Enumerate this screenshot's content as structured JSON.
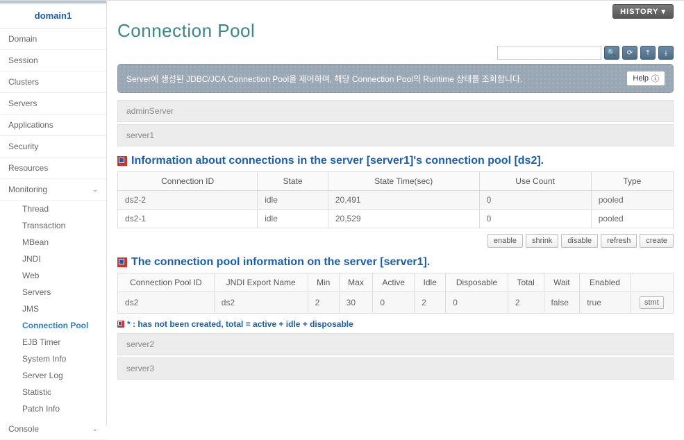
{
  "sidebar": {
    "domain": "domain1",
    "items": [
      "Domain",
      "Session",
      "Clusters",
      "Servers",
      "Applications",
      "Security",
      "Resources"
    ],
    "monitoring_label": "Monitoring",
    "monitoring_items": [
      "Thread",
      "Transaction",
      "MBean",
      "JNDI",
      "Web",
      "Servers",
      "JMS",
      "Connection Pool",
      "EJB Timer",
      "System Info",
      "Server Log",
      "Statistic",
      "Patch Info"
    ],
    "active_monitoring_item": "Connection Pool",
    "console_label": "Console"
  },
  "topbar": {
    "history": "HISTORY"
  },
  "page": {
    "title": "Connection Pool",
    "description": "Server에 생성된 JDBC/JCA Connection Pool을 제어하며, 해당 Connection Pool의 Runtime 상태를 조회합니다.",
    "help": "Help"
  },
  "servers_top": [
    "adminServer",
    "server1"
  ],
  "section1": {
    "title": "Information about connections in the server [server1]'s connection pool [ds2].",
    "headers": [
      "Connection ID",
      "State",
      "State Time(sec)",
      "Use Count",
      "Type"
    ],
    "rows": [
      {
        "id": "ds2-2",
        "state": "idle",
        "time": "20,491",
        "count": "0",
        "type": "pooled"
      },
      {
        "id": "ds2-1",
        "state": "idle",
        "time": "20,529",
        "count": "0",
        "type": "pooled"
      }
    ]
  },
  "actions": [
    "enable",
    "shrink",
    "disable",
    "refresh",
    "create"
  ],
  "section2": {
    "title": "The connection pool information on the server [server1].",
    "headers": [
      "Connection Pool ID",
      "JNDI Export Name",
      "Min",
      "Max",
      "Active",
      "Idle",
      "Disposable",
      "Total",
      "Wait",
      "Enabled",
      ""
    ],
    "rows": [
      {
        "poolId": "ds2",
        "jndi": "ds2",
        "min": "2",
        "max": "30",
        "active": "0",
        "idle": "2",
        "disposable": "0",
        "total": "2",
        "wait": "false",
        "enabled": "true",
        "btn": "stmt"
      }
    ]
  },
  "note": "* : has not been created, total = active + idle + disposable",
  "servers_bottom": [
    "server2",
    "server3"
  ],
  "search": {
    "placeholder": ""
  }
}
